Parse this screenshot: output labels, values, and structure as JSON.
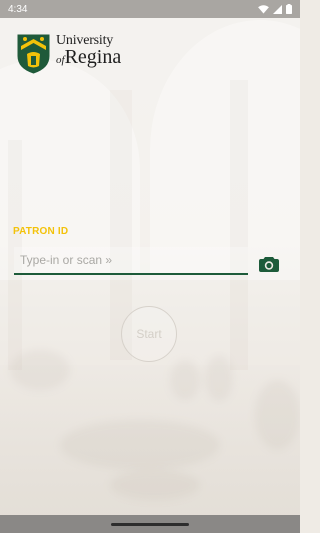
{
  "status_bar": {
    "time": "4:34",
    "icons": [
      "wifi-icon",
      "signal-icon",
      "battery-icon"
    ]
  },
  "logo": {
    "line1": "University",
    "line2_prefix": "of",
    "line2": "Regina",
    "crest_icon": "university-crest-icon"
  },
  "form": {
    "label": "PATRON ID",
    "placeholder": "Type-in or scan »",
    "value": "",
    "scan_icon": "camera-icon",
    "accent_color": "#f3c20a",
    "underline_color": "#1d5b3a"
  },
  "start": {
    "label": "Start"
  }
}
